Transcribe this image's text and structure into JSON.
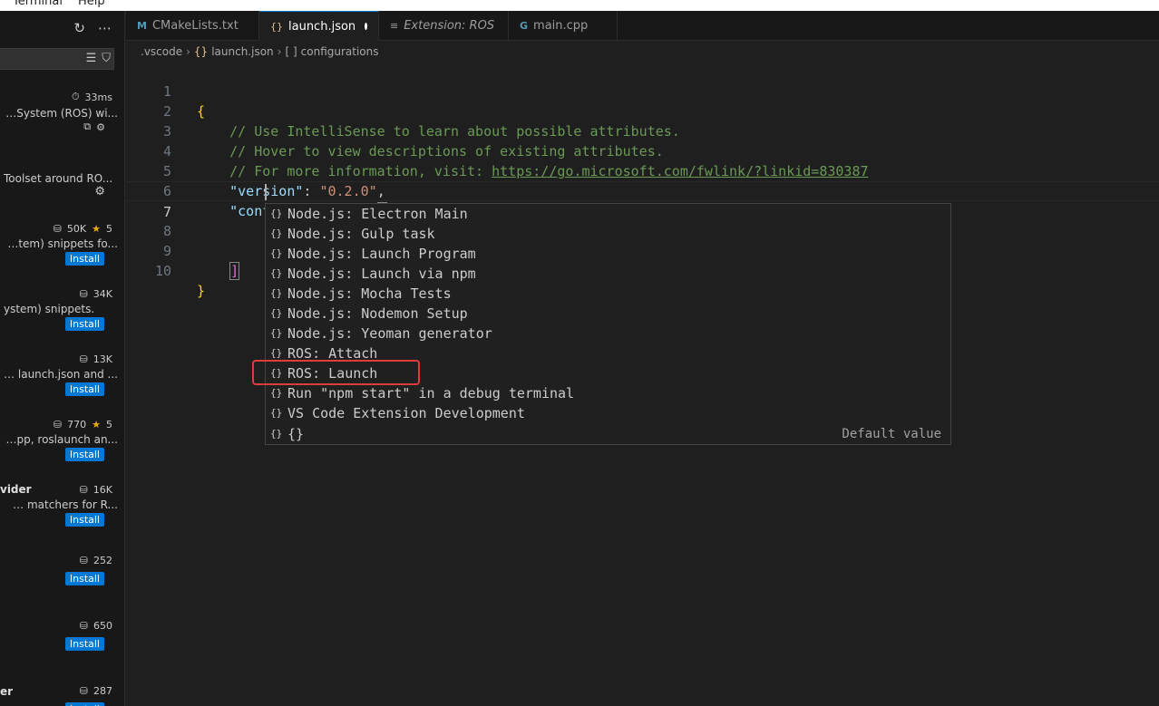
{
  "menubar": {
    "items": [
      "Terminal",
      "Help"
    ]
  },
  "sidebar": {
    "actions": [
      "refresh-icon",
      "more-icon"
    ],
    "search": {
      "value": ""
    },
    "extensions": [
      {
        "desc": "ng System (ROS) wi...",
        "meta": "33ms",
        "meta_icon": "clock-icon",
        "action": "gear"
      },
      {
        "desc": "Toolset around RO...",
        "meta": "",
        "action": "gear"
      },
      {
        "desc": "System) snippets fo...",
        "meta": "50K",
        "rating": "5",
        "action": "Install"
      },
      {
        "desc": "ystem) snippets.",
        "meta": "34K",
        "action": "Install"
      },
      {
        "desc": "for launch.json and ...",
        "meta": "13K",
        "action": "Install"
      },
      {
        "desc": "oscpp, roslaunch an...",
        "meta": "770",
        "rating": "5",
        "action": "Install"
      },
      {
        "name": "vider",
        "desc": "blem matchers for R...",
        "meta": "16K",
        "action": "Install"
      },
      {
        "desc": "",
        "meta": "252",
        "action": "Install"
      },
      {
        "desc": "",
        "meta": "650",
        "action": "Install"
      },
      {
        "name": "er",
        "desc": "",
        "meta": "287",
        "action": "Install"
      }
    ],
    "install_label": "Install"
  },
  "tabs": [
    {
      "label": "CMakeLists.txt",
      "icon": "M",
      "active": false
    },
    {
      "label": "launch.json",
      "icon": "{}",
      "active": true,
      "modified": true
    },
    {
      "label": "Extension: ROS",
      "icon": "≡",
      "active": false,
      "italic": true
    },
    {
      "label": "main.cpp",
      "icon": "G",
      "active": false
    }
  ],
  "breadcrumb": [
    ".vscode",
    "launch.json",
    "configurations"
  ],
  "editor": {
    "line_numbers": [
      "1",
      "2",
      "3",
      "4",
      "5",
      "6",
      "7",
      "8",
      "9",
      "10"
    ],
    "comment1": "// Use IntelliSense to learn about possible attributes.",
    "comment2": "// Hover to view descriptions of existing attributes.",
    "comment3_prefix": "// For more information, visit: ",
    "comment3_link": "https://go.microsoft.com/fwlink/?linkid=830387",
    "version_key": "\"version\"",
    "version_val": "\"0.2.0\"",
    "config_key": "\"configurations\""
  },
  "suggestions": {
    "items": [
      "Node.js: Electron Main",
      "Node.js: Gulp task",
      "Node.js: Launch Program",
      "Node.js: Launch via npm",
      "Node.js: Mocha Tests",
      "Node.js: Nodemon Setup",
      "Node.js: Yeoman generator",
      "ROS: Attach",
      "ROS: Launch",
      "Run \"npm start\" in a debug terminal",
      "VS Code Extension Development",
      "{}"
    ],
    "default_detail": "Default value"
  }
}
